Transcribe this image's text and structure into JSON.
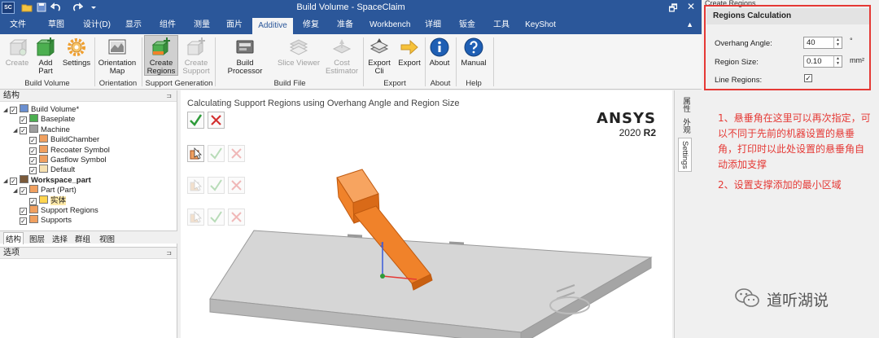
{
  "window": {
    "title": "Build Volume - SpaceClaim",
    "app_icon_text": "SC",
    "controls": [
      "🗗",
      "✕"
    ]
  },
  "menu_tabs": [
    "文件",
    "草图",
    "设计(D)",
    "显示",
    "组件",
    "测量",
    "面片",
    "Additive",
    "修复",
    "准备",
    "Workbench",
    "详细",
    "钣金",
    "工具",
    "KeyShot"
  ],
  "active_tab": "Additive",
  "ribbon": {
    "buttons": {
      "create": "Create",
      "add_part": "Add\nPart",
      "settings": "Settings",
      "orientation_map": "Orientation\nMap",
      "create_regions": "Create\nRegions",
      "create_support": "Create\nSupport",
      "build_processor": "Build Processor",
      "slice_viewer": "Slice Viewer",
      "cost_estimator": "Cost\nEstimator",
      "export_cli": "Export\nCli",
      "export": "Export",
      "about": "About",
      "manual": "Manual"
    },
    "groups": {
      "build_volume": "Build Volume",
      "orientation": "Orientation",
      "support_generation": "Support Generation",
      "build_file": "Build File",
      "export": "Export",
      "about": "About",
      "help": "Help"
    }
  },
  "structure_panel": {
    "title": "结构",
    "tree": [
      {
        "label": "Build Volume*",
        "level": 0,
        "expanded": true,
        "bold": false
      },
      {
        "label": "Baseplate",
        "level": 1,
        "expanded": false,
        "bold": false
      },
      {
        "label": "Machine",
        "level": 1,
        "expanded": true,
        "bold": false
      },
      {
        "label": "BuildChamber",
        "level": 2,
        "expanded": false,
        "bold": false
      },
      {
        "label": "Recoater Symbol",
        "level": 2,
        "expanded": false,
        "bold": false
      },
      {
        "label": "Gasflow Symbol",
        "level": 2,
        "expanded": false,
        "bold": false
      },
      {
        "label": "Default",
        "level": 2,
        "expanded": false,
        "bold": false
      },
      {
        "label": "Workspace_part",
        "level": 0,
        "expanded": true,
        "bold": true
      },
      {
        "label": "Part (Part)",
        "level": 1,
        "expanded": true,
        "bold": false
      },
      {
        "label": "实体",
        "level": 2,
        "expanded": false,
        "bold": false
      },
      {
        "label": "Support Regions",
        "level": 1,
        "expanded": false,
        "bold": false
      },
      {
        "label": "Supports",
        "level": 1,
        "expanded": false,
        "bold": false
      }
    ],
    "subtabs": [
      "结构",
      "图层",
      "选择",
      "群组",
      "视图"
    ]
  },
  "options_panel": {
    "title": "选项"
  },
  "viewport": {
    "title": "Calculating Support Regions using Overhang Angle and Region Size",
    "brand": "ANSYS",
    "version_prefix": "2020 ",
    "version_bold": "R2",
    "axis_label": "z"
  },
  "side_tabs": [
    "属性",
    "外观",
    "Settings"
  ],
  "regions_panel": {
    "panel_title": "Create Regions",
    "section_title": "Regions Calculation",
    "overhang_label": "Overhang Angle:",
    "overhang_value": "40",
    "overhang_unit": "°",
    "region_size_label": "Region Size:",
    "region_size_value": "0.10",
    "region_size_unit": "mm²",
    "line_regions_label": "Line Regions:",
    "line_regions_checked": true
  },
  "annotations": {
    "note1": "1、悬垂角在这里可以再次指定，可以不同于先前的机器设置的悬垂角，打印时以此处设置的悬垂角自动添加支撑",
    "note2": "2、设置支撑添加的最小区域",
    "watermark": "道听湖说"
  },
  "colors": {
    "title_bar": "#2b579a",
    "part_orange": "#f0822a",
    "accent_red": "#e53935",
    "check_green": "#2e9b3a",
    "cross_red": "#d32f2f"
  }
}
